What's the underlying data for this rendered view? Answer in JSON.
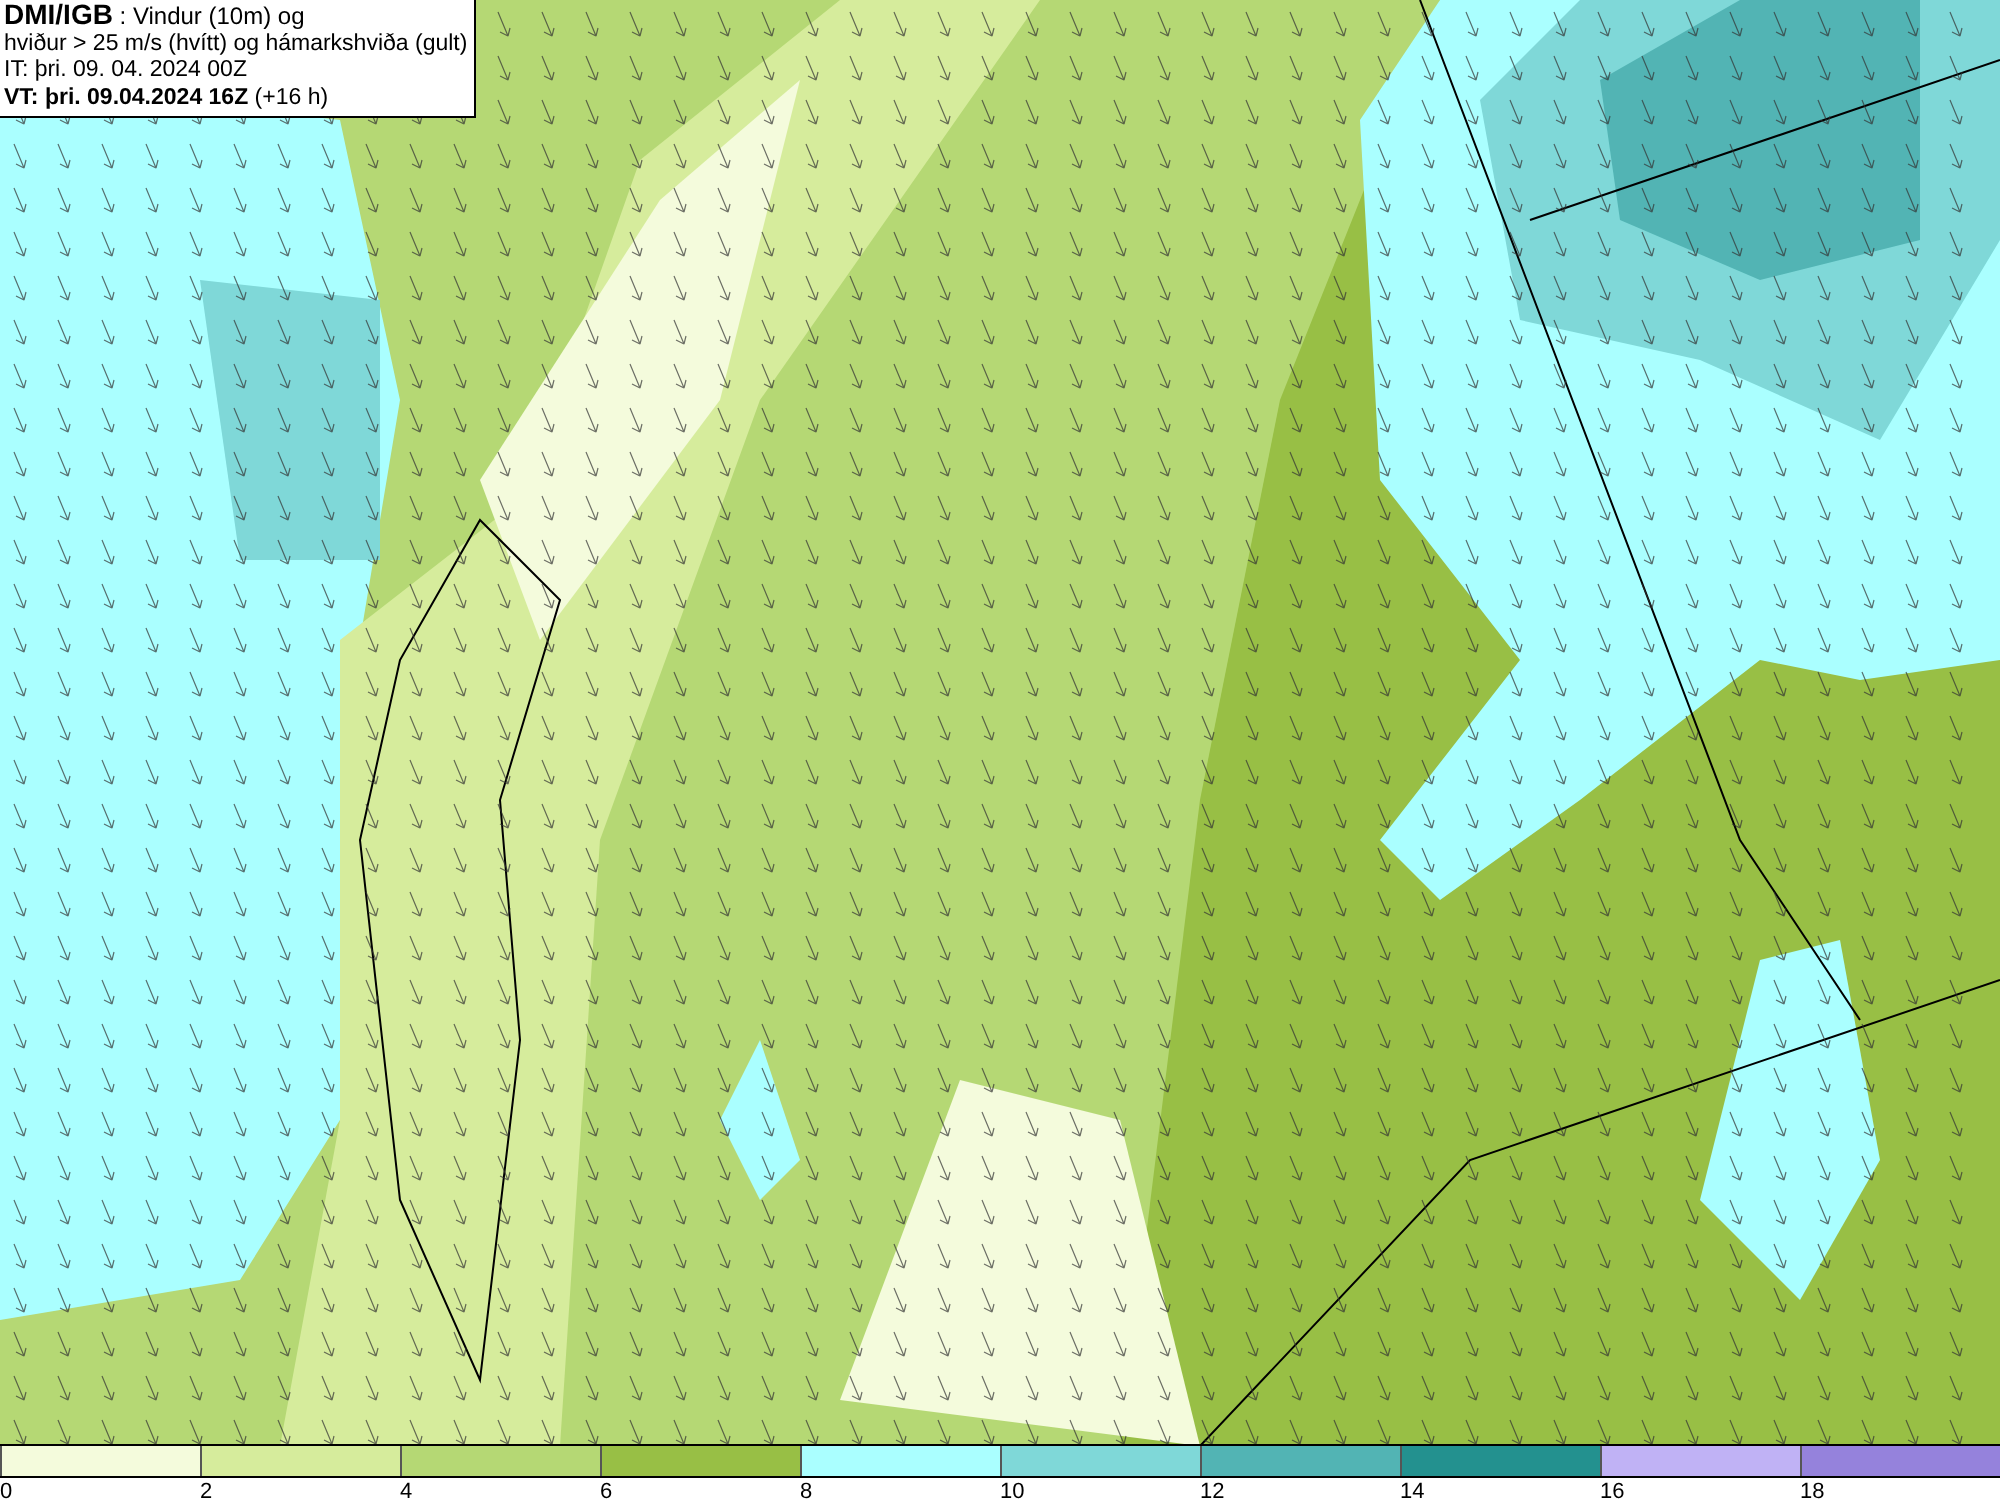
{
  "header": {
    "lines": [
      "**DMI/IGB** : Vindur (10m) og",
      "hviður > 25 m/s (hvítt) og hámarkshviða (gult)",
      "IT: þri. 09. 04. 2024 00Z",
      "**VT: þri. 09.04.2024 16Z** (+16 h)"
    ]
  },
  "legend": {
    "bins": [
      {
        "color": "#f4fbdc"
      },
      {
        "color": "#d6ec9c"
      },
      {
        "color": "#b5d874"
      },
      {
        "color": "#98bf45"
      },
      {
        "color": "#aaffff"
      },
      {
        "color": "#7fd8d8"
      },
      {
        "color": "#52b4b4"
      },
      {
        "color": "#23918f"
      },
      {
        "color": "#c0b2f5"
      },
      {
        "color": "#9582dc"
      }
    ],
    "labels": [
      "0",
      "2",
      "4",
      "6",
      "8",
      "10",
      "12",
      "14",
      "16",
      "18"
    ]
  }
}
